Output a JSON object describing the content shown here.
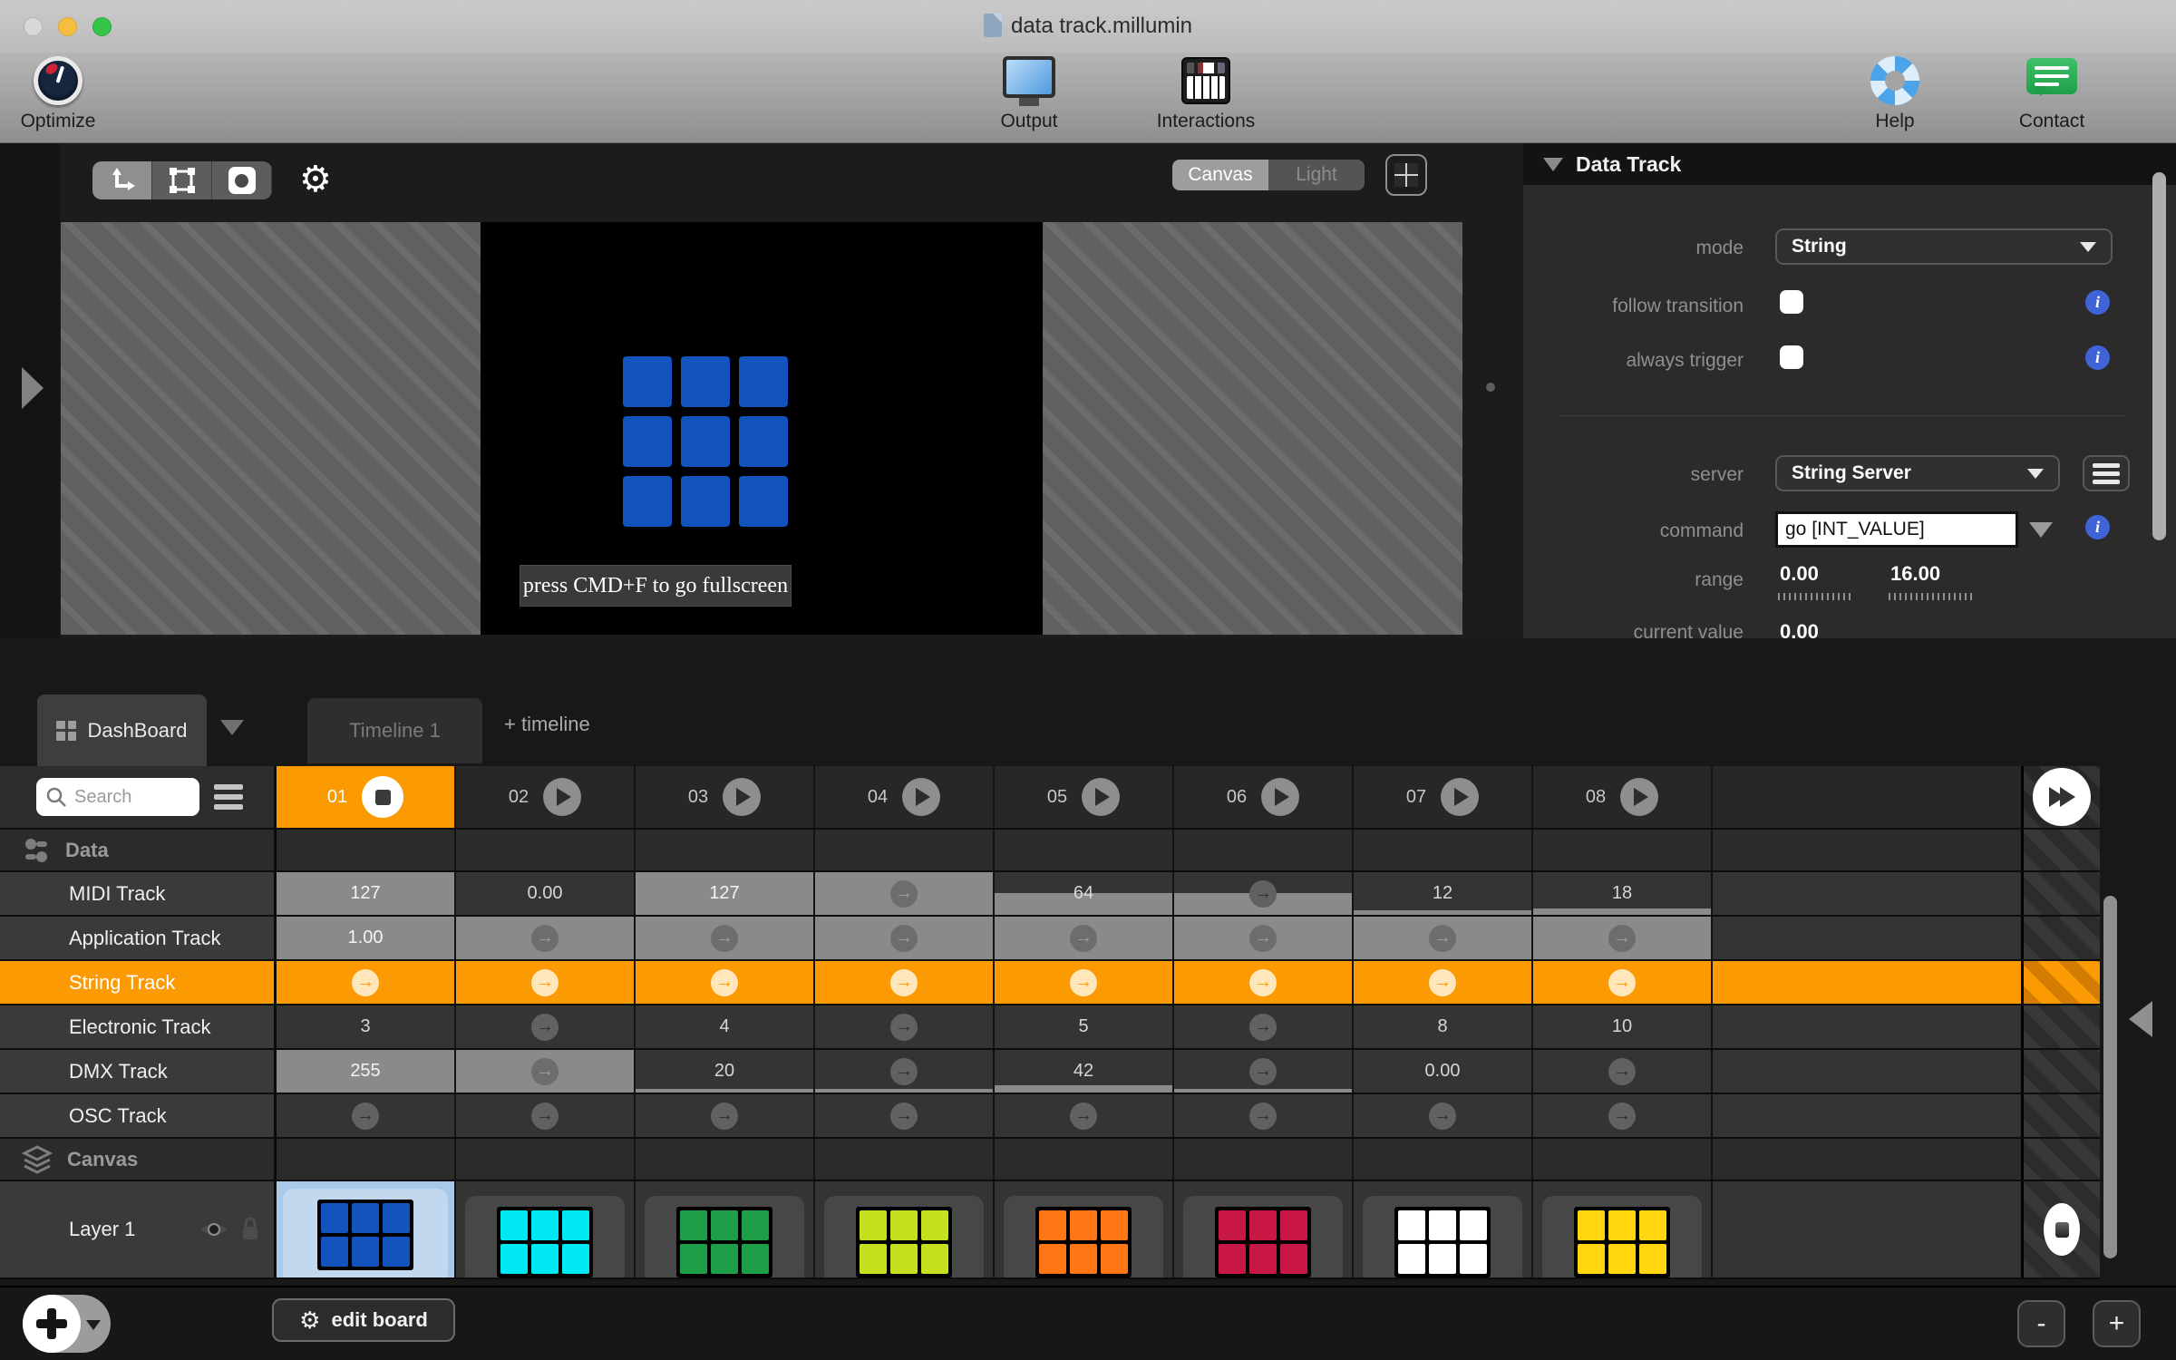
{
  "window": {
    "title": "data track.millumin"
  },
  "toolbar": {
    "optimize_label": "Optimize",
    "output_label": "Output",
    "interactions_label": "Interactions",
    "help_label": "Help",
    "contact_label": "Contact"
  },
  "preview": {
    "view_modes": [
      {
        "label": "Canvas",
        "active": true
      },
      {
        "label": "Light",
        "active": false
      }
    ],
    "fullscreen_hint": "press CMD+F to go fullscreen",
    "canvas_grid_color": "#1353bd"
  },
  "inspector": {
    "title": "Data Track",
    "mode_label": "mode",
    "mode_value": "String",
    "follow_transition_label": "follow transition",
    "follow_transition_checked": false,
    "always_trigger_label": "always trigger",
    "always_trigger_checked": false,
    "server_label": "server",
    "server_value": "String Server",
    "command_label": "command",
    "command_value": "go [INT_VALUE]",
    "range_label": "range",
    "range_min": "0.00",
    "range_max": "16.00",
    "current_value_label": "current value",
    "current_value": "0.00"
  },
  "dashboard": {
    "tabs": [
      {
        "label": "DashBoard",
        "active": true
      },
      {
        "label": "Timeline 1",
        "active": false
      }
    ],
    "add_timeline_label": "+ timeline",
    "search_placeholder": "Search",
    "edit_board_label": "edit board",
    "zoom_out_label": "-",
    "zoom_in_label": "+",
    "accent_color": "#fb9a02",
    "selection_color": "#a9c9ea",
    "columns": [
      {
        "id": "01",
        "control": "stop",
        "active": true
      },
      {
        "id": "02",
        "control": "play",
        "active": false
      },
      {
        "id": "03",
        "control": "play",
        "active": false
      },
      {
        "id": "04",
        "control": "play",
        "active": false
      },
      {
        "id": "05",
        "control": "play",
        "active": false
      },
      {
        "id": "06",
        "control": "play",
        "active": false
      },
      {
        "id": "07",
        "control": "play",
        "active": false
      },
      {
        "id": "08",
        "control": "play",
        "active": false
      }
    ],
    "rows": [
      {
        "kind": "group",
        "label": "Data",
        "icon": "data-group-icon"
      },
      {
        "kind": "track",
        "label": "MIDI Track",
        "cells": [
          {
            "text": "127",
            "fill": 1
          },
          {
            "text": "0.00",
            "fill": 0
          },
          {
            "text": "127",
            "fill": 1
          },
          {
            "arrow": true,
            "fill": 1
          },
          {
            "text": "64",
            "fill": 0.52
          },
          {
            "arrow": true,
            "fill": 0.52
          },
          {
            "text": "12",
            "fill": 0.1
          },
          {
            "text": "18",
            "fill": 0.14
          }
        ]
      },
      {
        "kind": "track",
        "label": "Application Track",
        "cells": [
          {
            "text": "1.00",
            "fill": 1
          },
          {
            "arrow": true,
            "fill": 1
          },
          {
            "arrow": true,
            "fill": 1
          },
          {
            "arrow": true,
            "fill": 1
          },
          {
            "arrow": true,
            "fill": 1
          },
          {
            "arrow": true,
            "fill": 1
          },
          {
            "arrow": true,
            "fill": 1
          },
          {
            "arrow": true,
            "fill": 1
          }
        ]
      },
      {
        "kind": "track",
        "label": "String Track",
        "highlight": true,
        "cells": [
          {
            "arrow": true,
            "fill": 0
          },
          {
            "arrow": true,
            "fill": 0
          },
          {
            "arrow": true,
            "fill": 0
          },
          {
            "arrow": true,
            "fill": 0
          },
          {
            "arrow": true,
            "fill": 0
          },
          {
            "arrow": true,
            "fill": 0
          },
          {
            "arrow": true,
            "fill": 0
          },
          {
            "arrow": true,
            "fill": 0
          }
        ]
      },
      {
        "kind": "track",
        "label": "Electronic Track",
        "cells": [
          {
            "text": "3",
            "fill": 0
          },
          {
            "arrow": true,
            "fill": 0
          },
          {
            "text": "4",
            "fill": 0
          },
          {
            "arrow": true,
            "fill": 0
          },
          {
            "text": "5",
            "fill": 0
          },
          {
            "arrow": true,
            "fill": 0
          },
          {
            "text": "8",
            "fill": 0
          },
          {
            "text": "10",
            "fill": 0
          }
        ]
      },
      {
        "kind": "track",
        "label": "DMX Track",
        "cells": [
          {
            "text": "255",
            "fill": 1
          },
          {
            "arrow": true,
            "fill": 1
          },
          {
            "text": "20",
            "fill": 0.08
          },
          {
            "arrow": true,
            "fill": 0.08
          },
          {
            "text": "42",
            "fill": 0.17
          },
          {
            "arrow": true,
            "fill": 0.08
          },
          {
            "text": "0.00",
            "fill": 0
          },
          {
            "arrow": true,
            "fill": 0
          }
        ]
      },
      {
        "kind": "track",
        "label": "OSC Track",
        "cells": [
          {
            "arrow": true,
            "fill": 0
          },
          {
            "arrow": true,
            "fill": 0
          },
          {
            "arrow": true,
            "fill": 0
          },
          {
            "arrow": true,
            "fill": 0
          },
          {
            "arrow": true,
            "fill": 0
          },
          {
            "arrow": true,
            "fill": 0
          },
          {
            "arrow": true,
            "fill": 0
          },
          {
            "arrow": true,
            "fill": 0
          }
        ]
      },
      {
        "kind": "group",
        "label": "Canvas",
        "icon": "layers-group-icon"
      },
      {
        "kind": "layer",
        "label": "Layer 1",
        "thumbnails": [
          {
            "color": "#1353bd",
            "selected": true
          },
          {
            "color": "#00e9f2",
            "selected": false
          },
          {
            "color": "#1d9e48",
            "selected": false
          },
          {
            "color": "#c6e01f",
            "selected": false
          },
          {
            "color": "#ff7714",
            "selected": false
          },
          {
            "color": "#c81744",
            "selected": false
          },
          {
            "color": "#ffffff",
            "selected": false
          },
          {
            "color": "#ffd60f",
            "selected": false
          }
        ]
      }
    ]
  }
}
